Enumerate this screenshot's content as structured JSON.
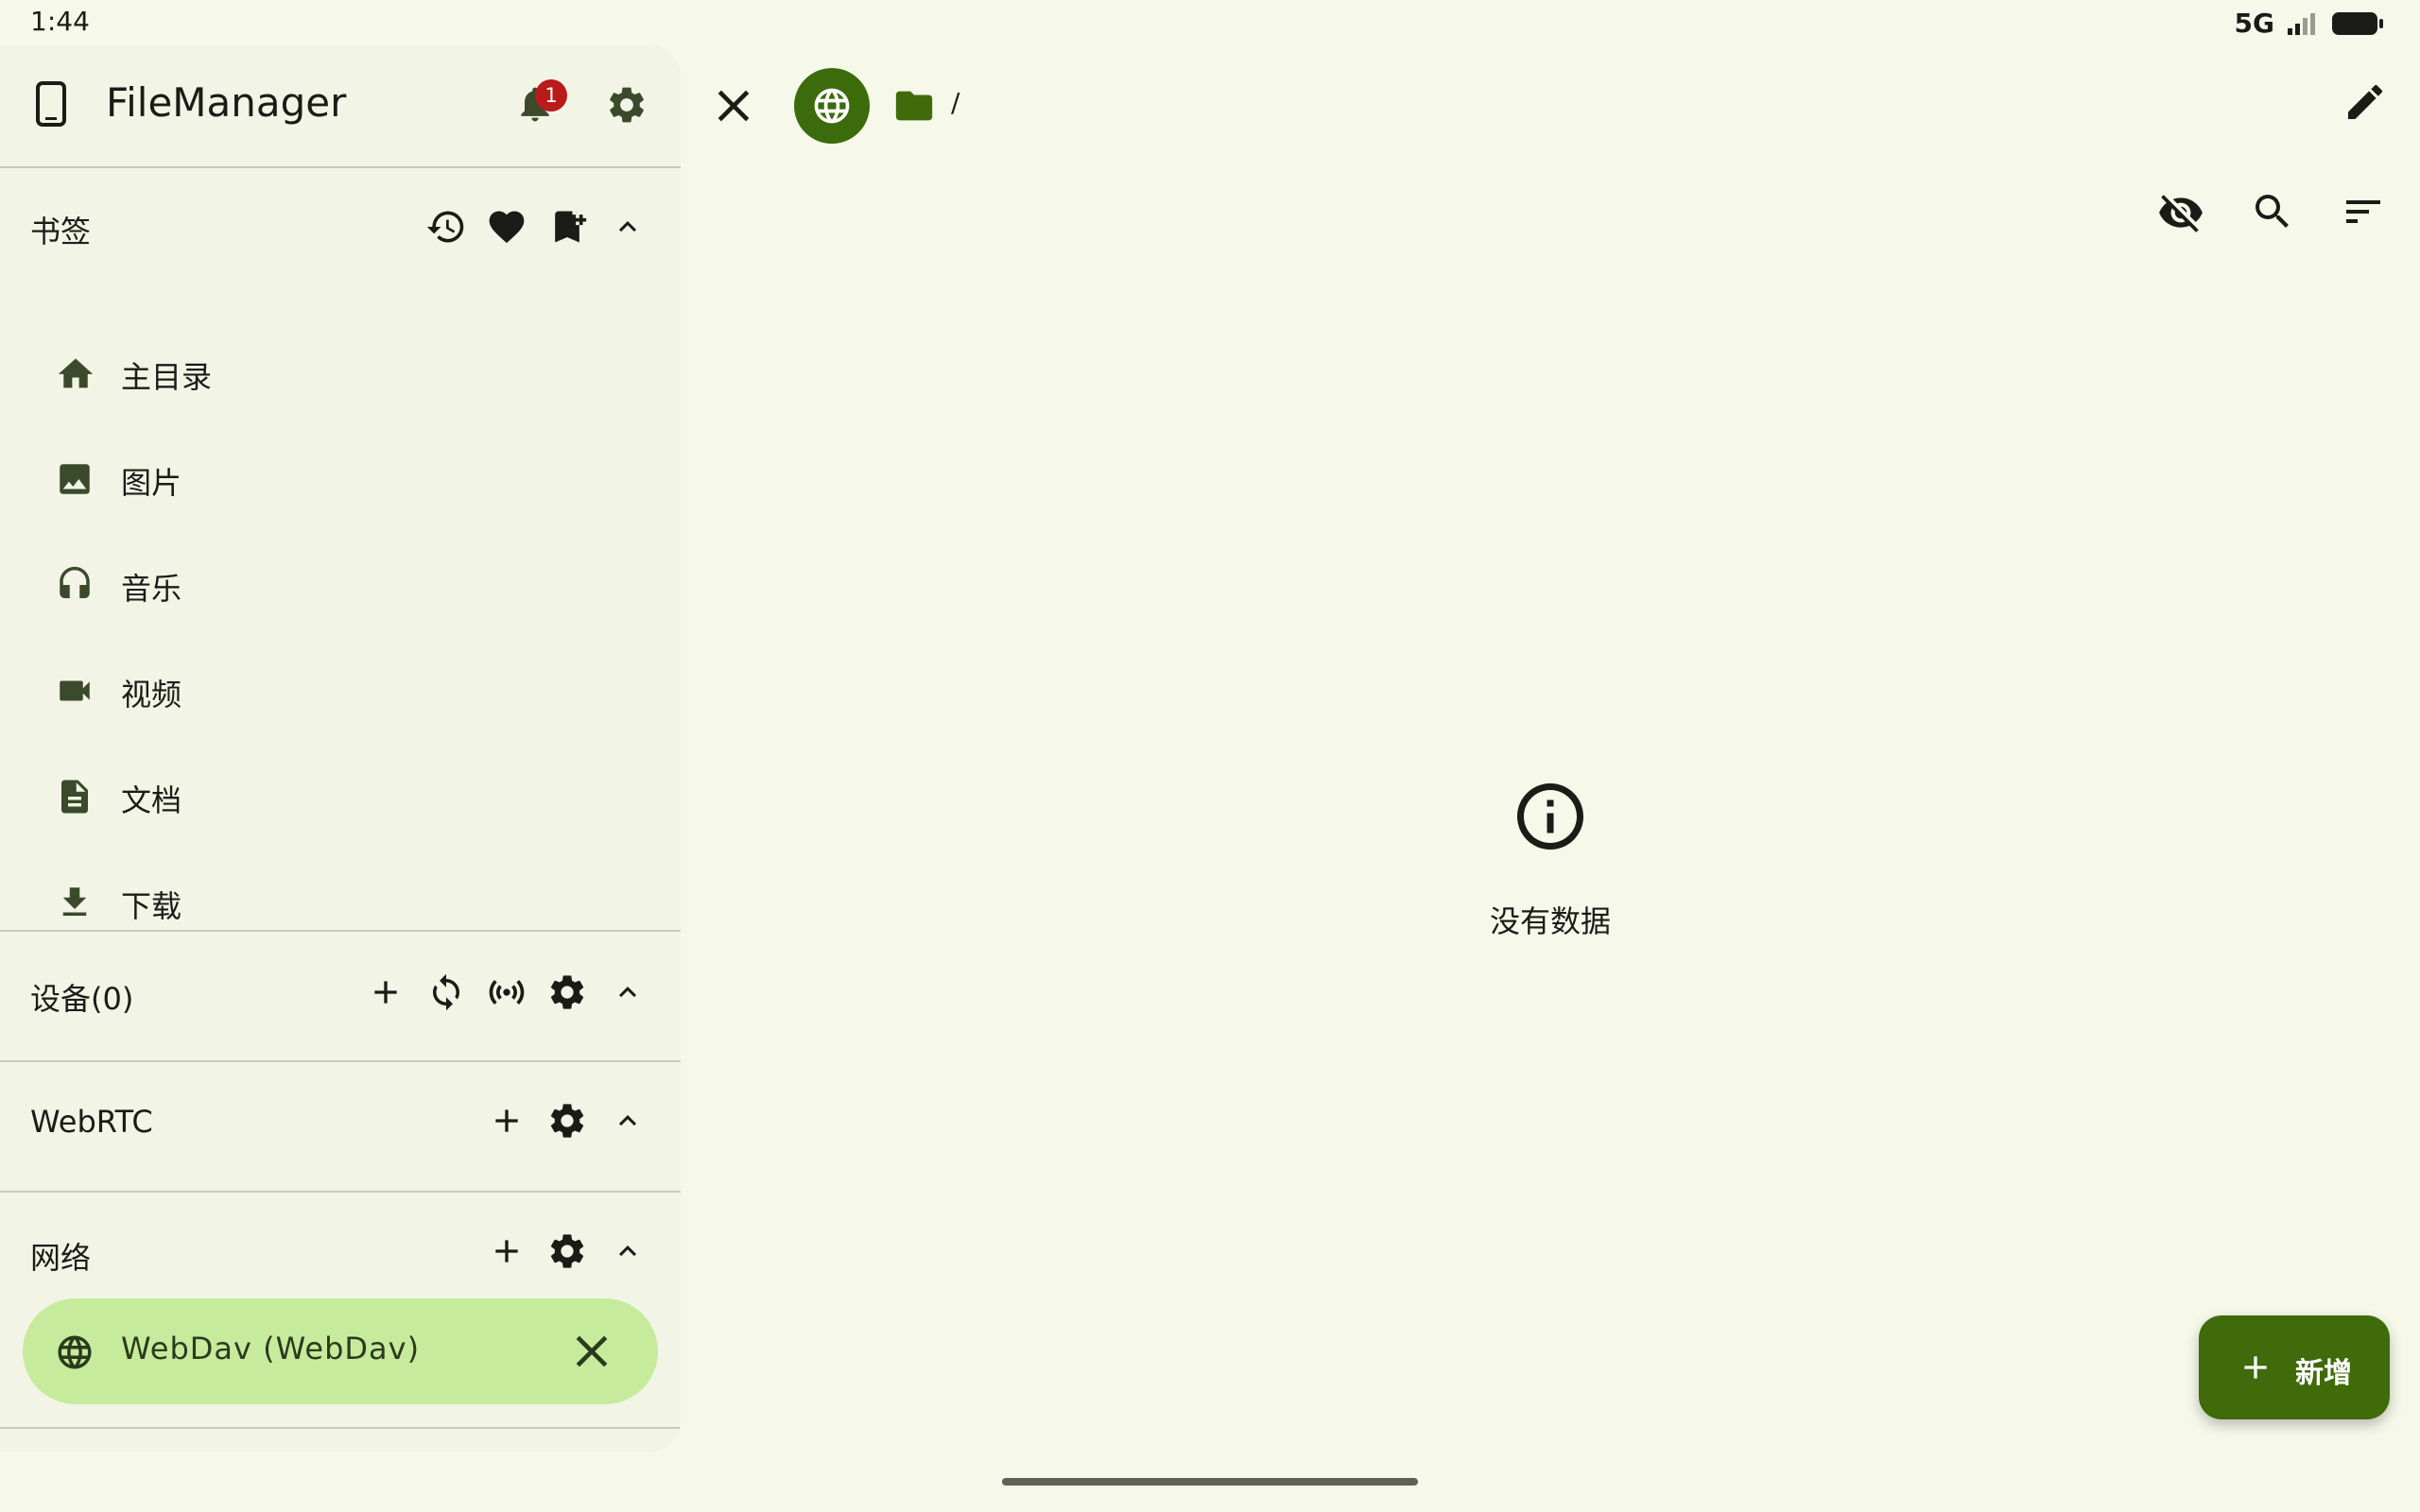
{
  "status_bar": {
    "time": "1:44",
    "network": "5G"
  },
  "app": {
    "title": "FileManager",
    "notification_count": "1"
  },
  "bookmarks": {
    "title": "书签",
    "items": [
      {
        "label": "主目录",
        "icon": "home-icon"
      },
      {
        "label": "图片",
        "icon": "image-icon"
      },
      {
        "label": "音乐",
        "icon": "headphones-icon"
      },
      {
        "label": "视频",
        "icon": "videocam-icon"
      },
      {
        "label": "文档",
        "icon": "document-icon"
      },
      {
        "label": "下载",
        "icon": "download-icon"
      }
    ]
  },
  "devices": {
    "title": "设备(0)"
  },
  "webrtc": {
    "title": "WebRTC"
  },
  "network": {
    "title": "网络",
    "items": [
      {
        "label": "WebDav (WebDav)",
        "icon": "globe-icon"
      }
    ]
  },
  "breadcrumb": {
    "separator": "/"
  },
  "empty_state": {
    "text": "没有数据"
  },
  "fab": {
    "label": "新增"
  },
  "colors": {
    "background": "#f6f9ea",
    "drawer": "#f2f4e6",
    "accent": "#3f6b0a",
    "selected_item": "#c6eb9c",
    "badge": "#ba1a1a"
  }
}
